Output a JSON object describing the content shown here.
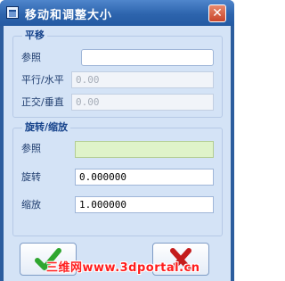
{
  "window": {
    "title": "移动和调整大小"
  },
  "translate_group": {
    "legend": "平移",
    "reference_label": "参照",
    "reference_value": "",
    "horizontal_label": "平行/水平",
    "horizontal_value": "0.00",
    "vertical_label": "正交/垂直",
    "vertical_value": "0.00"
  },
  "rotate_scale_group": {
    "legend": "旋转/缩放",
    "reference_label": "参照",
    "reference_value": "",
    "rotate_label": "旋转",
    "rotate_value": "0.000000",
    "scale_label": "缩放",
    "scale_value": "1.000000"
  },
  "buttons": {
    "ok_icon": "checkmark-icon",
    "cancel_icon": "x-icon"
  },
  "watermark": {
    "text": "三维网www.3dportal.cn"
  },
  "colors": {
    "title_bar": "#2d64ad",
    "client": "#d4e3f6",
    "ok_green": "#2fa62f",
    "cancel_red": "#c41c1c",
    "watermark": "#ff1c1c"
  }
}
